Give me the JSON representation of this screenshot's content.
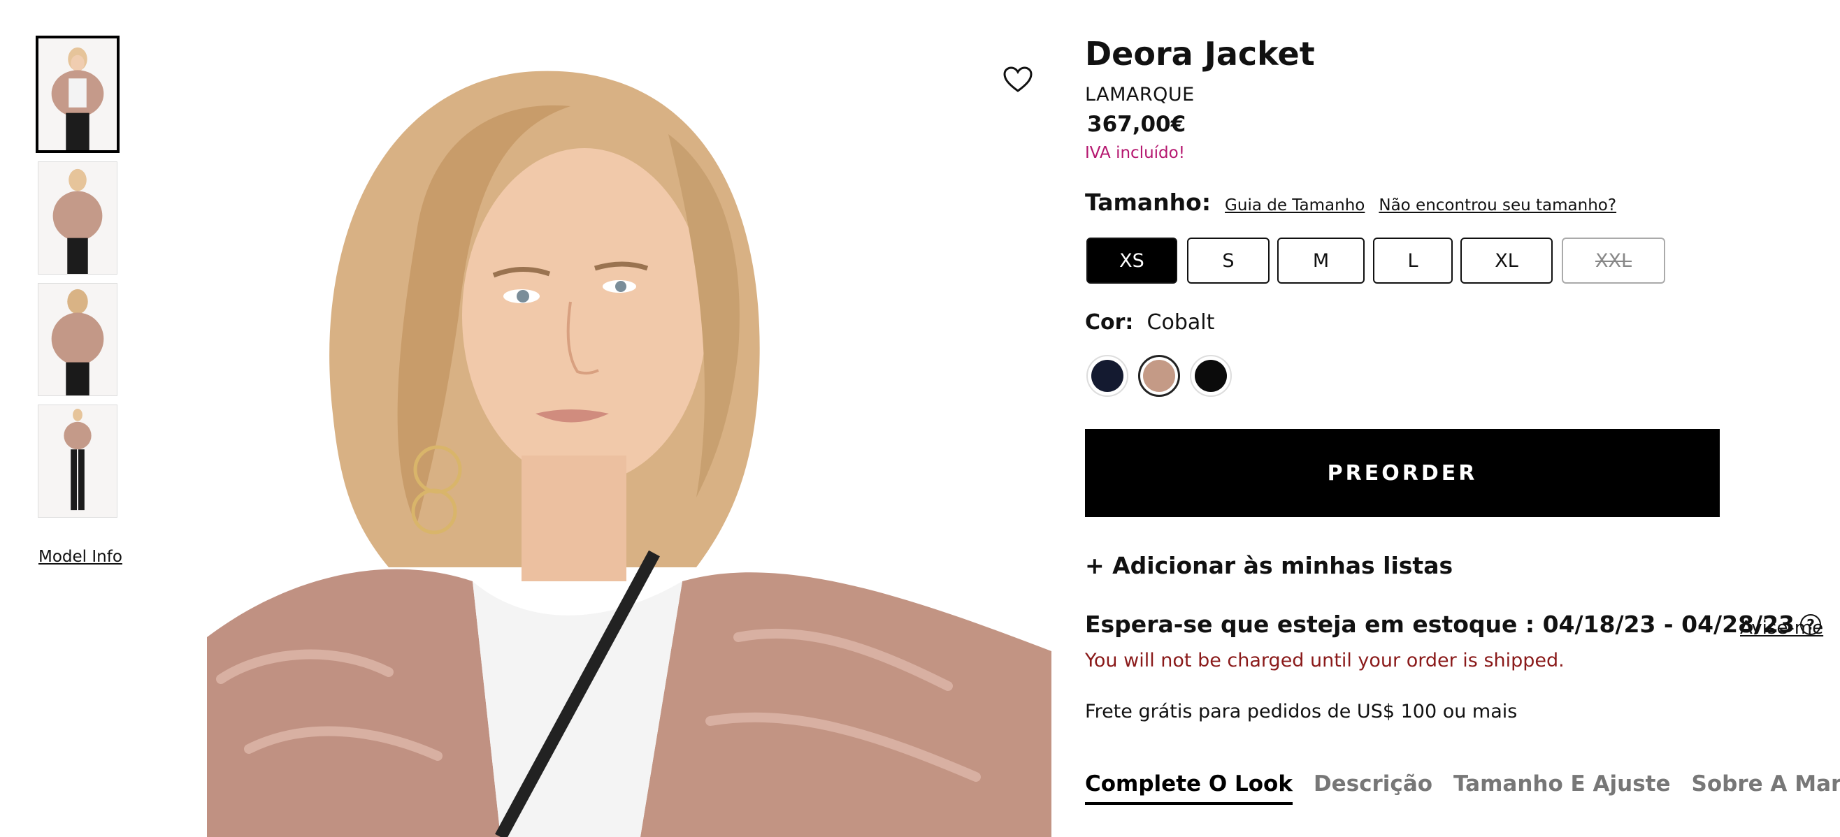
{
  "product": {
    "title": "Deora Jacket",
    "brand": "LAMARQUE",
    "price": "367,00€",
    "vat_note": "IVA incluído!"
  },
  "gallery": {
    "thumbnails": [
      "thumbnail-front",
      "thumbnail-side",
      "thumbnail-back",
      "thumbnail-full"
    ],
    "model_info_label": "Model Info"
  },
  "size": {
    "label": "Tamanho:",
    "guide_link": "Guia de Tamanho",
    "not_found_link": "Não encontrou seu tamanho?",
    "options": [
      "XS",
      "S",
      "M",
      "L",
      "XL",
      "XXL"
    ],
    "selected": "XS",
    "unavailable": [
      "XXL"
    ]
  },
  "color": {
    "label": "Cor:",
    "value": "Cobalt",
    "swatches": [
      {
        "name": "navy",
        "hex": "#141a30"
      },
      {
        "name": "blush",
        "hex": "#c49a86"
      },
      {
        "name": "black",
        "hex": "#0b0b0b"
      }
    ]
  },
  "actions": {
    "preorder": "PREORDER",
    "add_to_lists": "+ Adicionar às minhas listas",
    "notify_me": "Avise-me"
  },
  "stock": {
    "expected": "Espera-se que esteja em estoque : 04/18/23 - 04/28/23",
    "help_icon": "?",
    "charge_note": "You will not be charged until your order is shipped."
  },
  "shipping": "Frete grátis para pedidos de US$ 100 ou mais",
  "tabs": [
    {
      "label": "Complete O Look",
      "active": true
    },
    {
      "label": "Descrição",
      "active": false
    },
    {
      "label": "Tamanho E Ajuste",
      "active": false
    },
    {
      "label": "Sobre A Marca",
      "active": false
    }
  ],
  "colors": {
    "accent_vat": "#b5176f",
    "charge_note": "#8a1a1a",
    "primary": "#000000"
  }
}
